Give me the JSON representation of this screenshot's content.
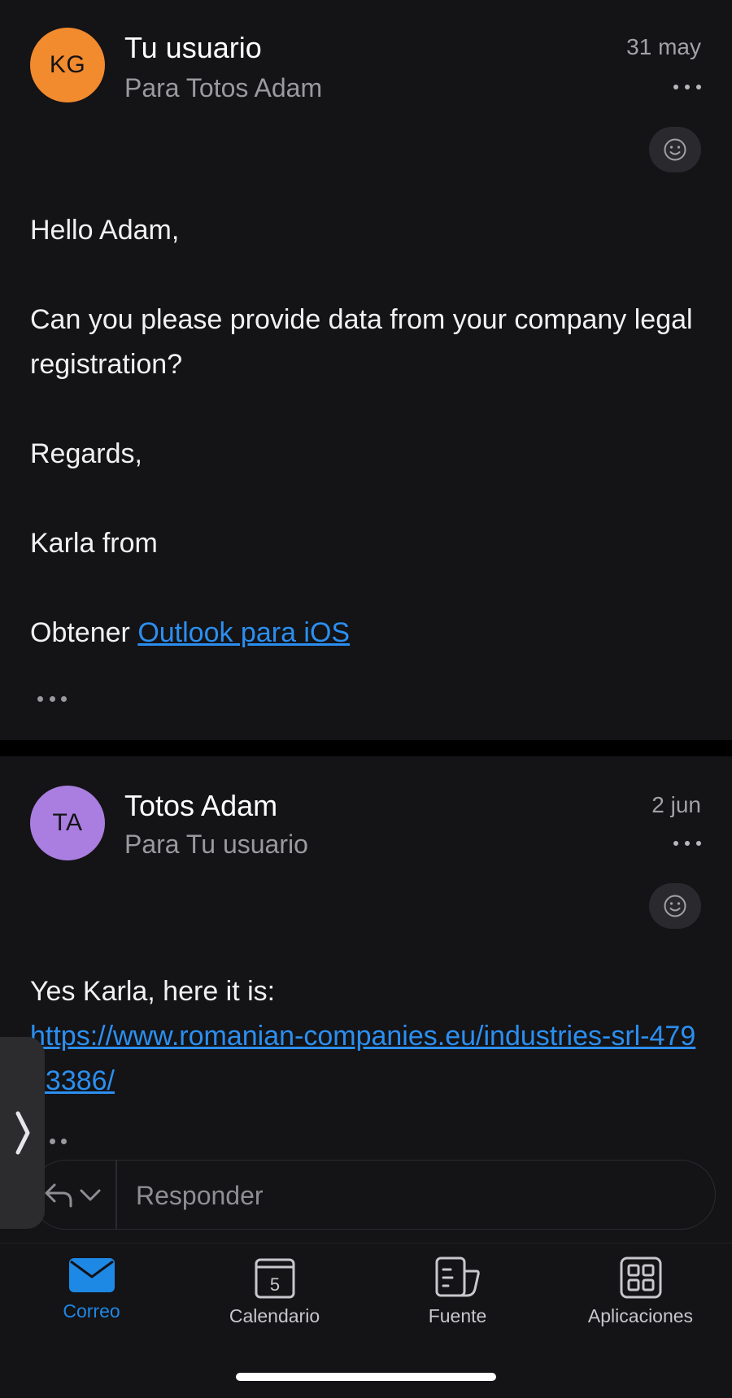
{
  "messages": [
    {
      "avatar_initials": "KG",
      "avatar_color": "#f28a2e",
      "sender": "Tu usuario",
      "recipient": "Para Totos Adam",
      "date": "31 may",
      "body": {
        "greeting": "Hello Adam,",
        "line1": "Can you please provide data from your company legal registration?",
        "regards": "Regards,",
        "signature": "Karla from",
        "footer_prefix": "Obtener",
        "footer_link": "Outlook para iOS"
      }
    },
    {
      "avatar_initials": "TA",
      "avatar_color": "#a97ee0",
      "sender": "Totos Adam",
      "recipient": "Para Tu usuario",
      "date": "2 jun",
      "body": {
        "line1": "Yes Karla, here it is:",
        "link": "https://www.romanian-companies.eu/industries-srl-47913386/"
      }
    }
  ],
  "reply": {
    "placeholder": "Responder"
  },
  "tabbar": {
    "items": [
      {
        "label": "Correo",
        "icon": "mail-icon",
        "active": true
      },
      {
        "label": "Calendario",
        "icon": "calendar-icon",
        "day": "5"
      },
      {
        "label": "Fuente",
        "icon": "feed-icon"
      },
      {
        "label": "Aplicaciones",
        "icon": "apps-icon"
      }
    ]
  },
  "colors": {
    "accent": "#1e88e5",
    "link": "#2b8ff0",
    "background": "#141316"
  }
}
